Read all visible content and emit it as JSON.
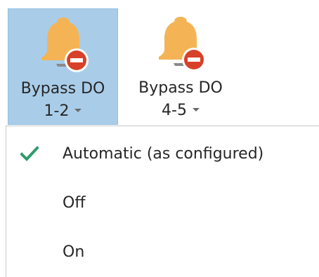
{
  "ribbon": {
    "buttons": [
      {
        "line1": "Bypass DO",
        "line2": "1-2",
        "icon": "bell-blocked-icon",
        "state": "pressed"
      },
      {
        "line1": "Bypass DO",
        "line2": "4-5",
        "icon": "bell-blocked-icon",
        "state": "normal"
      }
    ]
  },
  "menu": {
    "items": [
      {
        "label": "Automatic (as configured)",
        "checked": true
      },
      {
        "label": "Off",
        "checked": false
      },
      {
        "label": "On",
        "checked": false
      }
    ]
  },
  "colors": {
    "bell": "#f4b456",
    "bell_shadow": "#8a8a8a",
    "stop_badge": "#d8402a",
    "pressed_background": "#a9cde9",
    "check": "#2e9c6b",
    "text": "#262626"
  }
}
